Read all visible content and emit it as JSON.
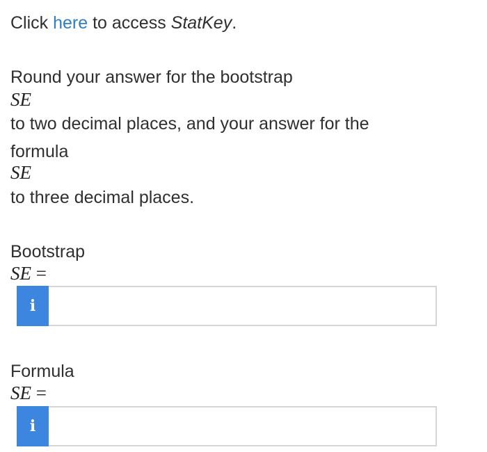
{
  "intro": {
    "prefix": "Click ",
    "link_text": "here",
    "middle": " to access ",
    "app_name": "StatKey",
    "suffix": "."
  },
  "instructions": {
    "line1": "Round your answer for the bootstrap",
    "se1": "SE",
    "line2": "to two decimal places, and your answer for the",
    "line3": "formula",
    "se2": "SE",
    "line4": "to three decimal places."
  },
  "bootstrap": {
    "label": "Bootstrap",
    "se_symbol": "SE",
    "equals": "=",
    "info_icon": "i",
    "value": ""
  },
  "formula": {
    "label": "Formula",
    "se_symbol": "SE",
    "equals": "=",
    "info_icon": "i",
    "value": ""
  },
  "colors": {
    "link": "#2f7fc4",
    "info_button": "#3d86e0"
  }
}
